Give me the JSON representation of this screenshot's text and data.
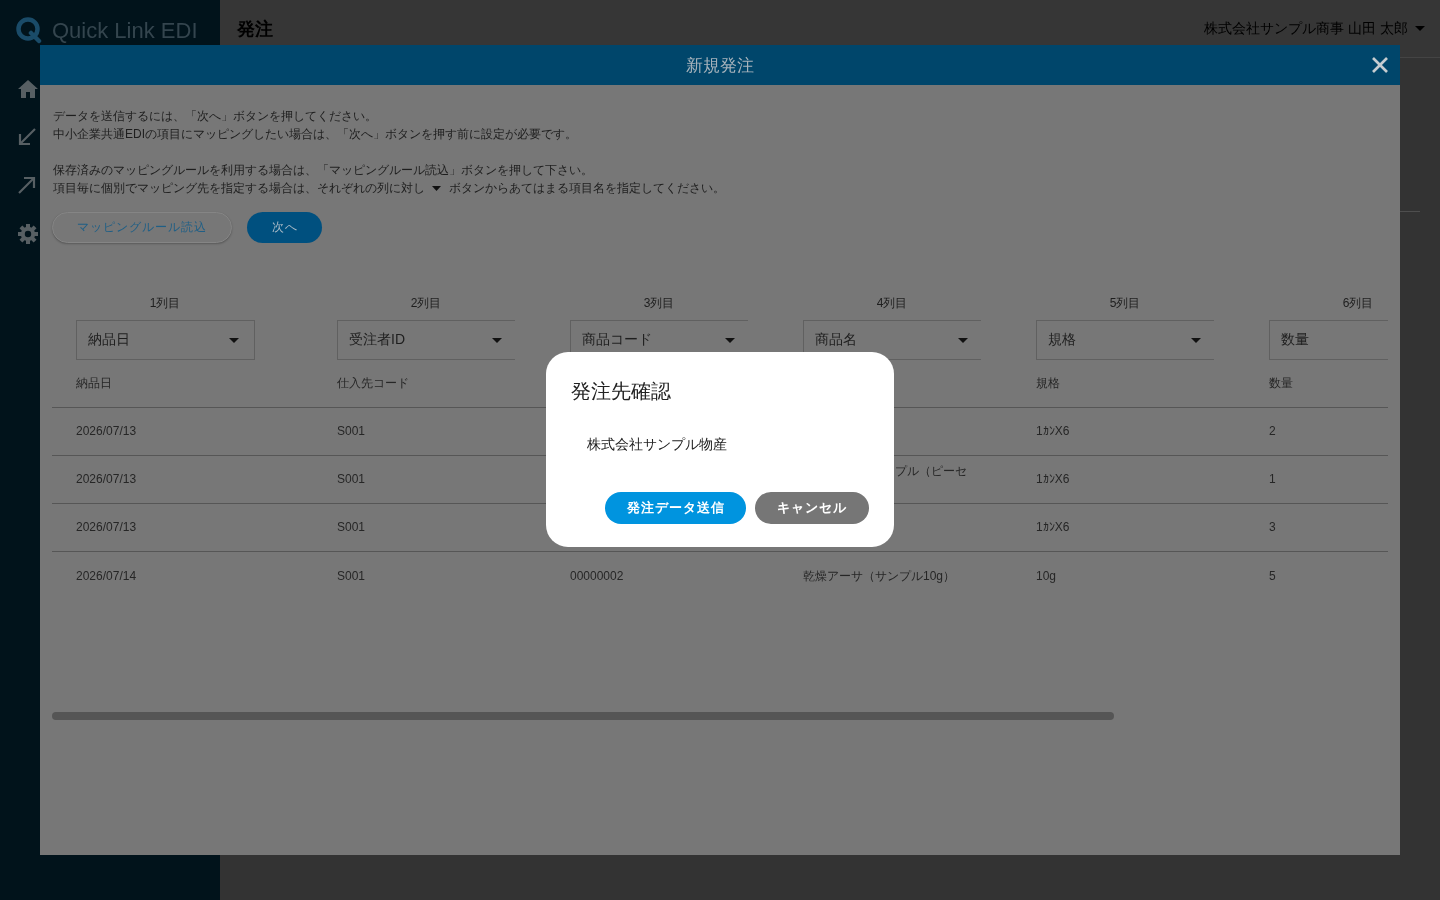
{
  "sidebar": {
    "logo": "Quick Link EDI"
  },
  "header": {
    "title": "発注",
    "user": "株式会社サンプル商事 山田 太郎"
  },
  "modal": {
    "title": "新規発注",
    "instructions": [
      {
        "lines": [
          {
            "text": "データを送信するには、「次へ」ボタンを押してください。"
          },
          {
            "text": "中小企業共通EDIの項目にマッピングしたい場合は、「次へ」ボタンを押す前に設定が必要です。"
          }
        ]
      },
      {
        "lines": [
          {
            "text": "保存済みのマッピングルールを利用する場合は、「マッピングルール読込」ボタンを押して下さい。"
          },
          {
            "text": "項目毎に個別でマッピング先を指定する場合は、それぞれの列に対し",
            "after_icon": "ボタンからあてはまる項目名を指定してください。"
          }
        ]
      }
    ],
    "buttons": [
      {
        "label": "マッピングルール読込",
        "kind": "outline"
      },
      {
        "label": "次へ",
        "kind": "primary"
      }
    ],
    "table": {
      "column_labels": [
        "1列目",
        "2列目",
        "3列目",
        "4列目",
        "5列目",
        "6列目"
      ],
      "mappings": [
        {
          "value": "納品日",
          "kind": "select"
        },
        {
          "value": "受注者ID",
          "kind": "select"
        },
        {
          "value": "商品コード",
          "kind": "select"
        },
        {
          "value": "商品名",
          "kind": "select"
        },
        {
          "value": "規格",
          "kind": "select"
        },
        {
          "value": "数量",
          "kind": "cut"
        }
      ],
      "headers": {
        "column_1": "納品日",
        "column_2": "仕入先コード",
        "column_5": "規格",
        "column_6": "数量"
      },
      "rows": [
        {
          "column_1": "2026/07/13",
          "column_2": "S001",
          "column_5": "1ｶﾝX6",
          "column_6": "2"
        },
        {
          "column_1": "2026/07/13",
          "column_2": "S001",
          "column_4": {
            "text": "プル（ピーセ",
            "kind": "cut"
          },
          "column_5": "1ｶﾝX6",
          "column_6": "1"
        },
        {
          "column_1": "2026/07/13",
          "column_2": "S001",
          "column_5": "1ｶﾝX6",
          "column_6": "3"
        },
        {
          "column_1": "2026/07/14",
          "column_2": "S001",
          "column_3": "00000002",
          "column_4": "乾燥アーサ（サンプル10g）",
          "column_5": "10g",
          "column_6": "5"
        }
      ]
    }
  },
  "confirm_dialog": {
    "title": "発注先確認",
    "message": "株式会社サンプル物産",
    "buttons": [
      {
        "label": "発注データ送信",
        "kind": "primary"
      },
      {
        "label": "キャンセル",
        "kind": "secondary"
      }
    ]
  }
}
